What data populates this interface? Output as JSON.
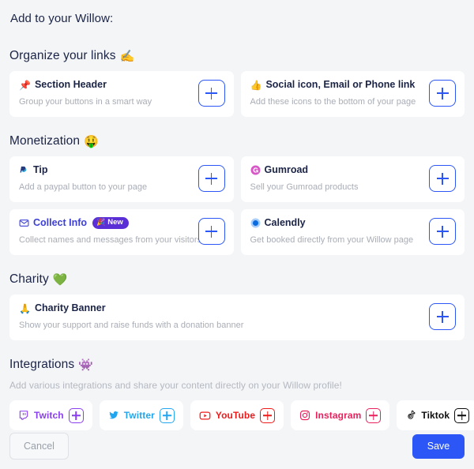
{
  "dialog": {
    "title": "Add to your Willow:"
  },
  "sections": {
    "organize": {
      "heading": "Organize your links",
      "emoji": "✍️",
      "cards": [
        {
          "emoji": "📌",
          "title": "Section Header",
          "desc": "Group your buttons in a smart way",
          "add_label": "+"
        },
        {
          "emoji": "👍",
          "title": "Social icon, Email or Phone link",
          "desc": "Add these icons to the bottom of your page",
          "add_label": "+"
        }
      ]
    },
    "monetization": {
      "heading": "Monetization",
      "emoji": "🤑",
      "cards": [
        {
          "icon": "paypal-icon",
          "title": "Tip",
          "desc": "Add a paypal button to your page",
          "add_label": "+"
        },
        {
          "icon": "gumroad-icon",
          "title": "Gumroad",
          "desc": "Sell your Gumroad products",
          "add_label": "+"
        },
        {
          "icon": "envelope-icon",
          "title": "Collect Info",
          "badge": {
            "emoji": "🎉",
            "label": "New"
          },
          "desc": "Collect names and messages from your visitors",
          "add_label": "+"
        },
        {
          "icon": "calendly-icon",
          "title": "Calendly",
          "desc": "Get booked directly from your Willow page",
          "add_label": "+"
        }
      ]
    },
    "charity": {
      "heading": "Charity",
      "emoji": "💚",
      "cards": [
        {
          "emoji": "🙏",
          "title": "Charity Banner",
          "desc": "Show your support and raise funds with a donation banner",
          "add_label": "+"
        }
      ]
    },
    "integrations": {
      "heading": "Integrations",
      "emoji": "👾",
      "desc": "Add various integrations and share your content directly on your Willow profile!",
      "chips": [
        {
          "icon": "twitch-icon",
          "label": "Twitch",
          "color": "#8a3ff0"
        },
        {
          "icon": "twitter-icon",
          "label": "Twitter",
          "color": "#23a6f0"
        },
        {
          "icon": "youtube-icon",
          "label": "YouTube",
          "color": "#ef1b1b"
        },
        {
          "icon": "instagram-icon",
          "label": "Instagram",
          "color": "#e8215c"
        },
        {
          "icon": "tiktok-icon",
          "label": "Tiktok",
          "color": "#0c0c0c"
        }
      ]
    }
  },
  "footer": {
    "cancel_label": "Cancel",
    "save_label": "Save"
  },
  "colors": {
    "accent": "#2c57f6",
    "page_bg": "#f4f5f7",
    "card_bg": "#ffffff",
    "heading": "#1b2446",
    "muted": "#a9adb6",
    "badge_purple": "#5b2fd6"
  }
}
